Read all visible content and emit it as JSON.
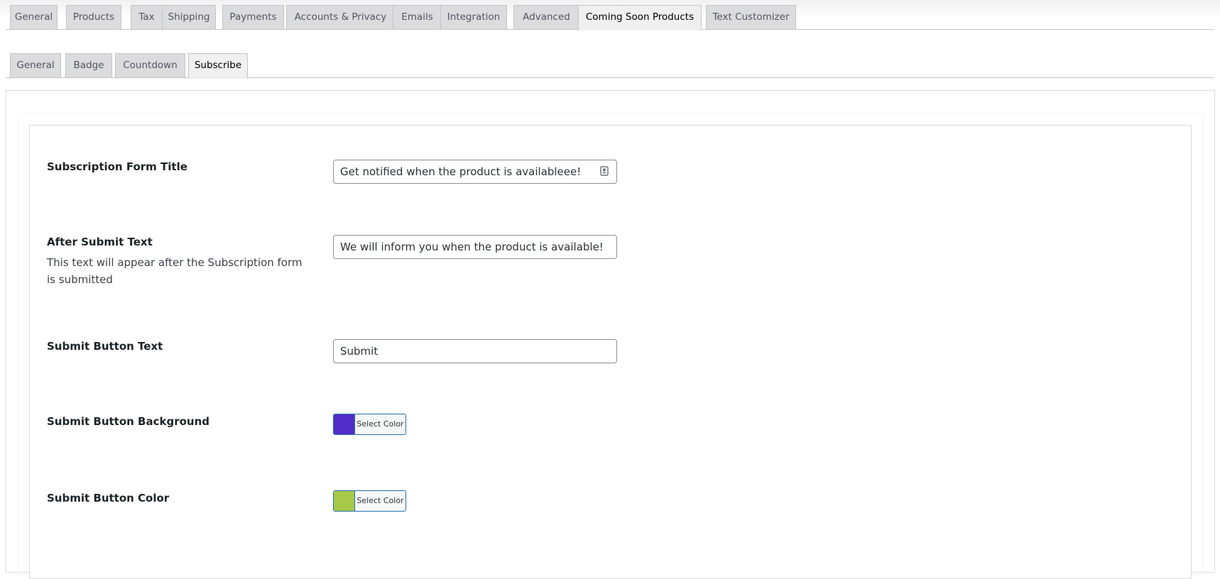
{
  "main_tabs": [
    {
      "label": "General",
      "active": false
    },
    {
      "label": "Products",
      "active": false
    },
    {
      "label": "Tax",
      "active": false
    },
    {
      "label": "Shipping",
      "active": false
    },
    {
      "label": "Payments",
      "active": false
    },
    {
      "label": "Accounts & Privacy",
      "active": false
    },
    {
      "label": "Emails",
      "active": false
    },
    {
      "label": "Integration",
      "active": false
    },
    {
      "label": "Advanced",
      "active": false
    },
    {
      "label": "Coming Soon Products",
      "active": true
    },
    {
      "label": "Text Customizer",
      "active": false
    }
  ],
  "sub_tabs": [
    {
      "label": "General",
      "active": false
    },
    {
      "label": "Badge",
      "active": false
    },
    {
      "label": "Countdown",
      "active": false
    },
    {
      "label": "Subscribe",
      "active": true
    }
  ],
  "form": {
    "title_label": "Subscription Form Title",
    "title_value": "Get notified when the product is availableee!",
    "after_submit_label": "After Submit Text",
    "after_submit_desc": "This text will appear after the Subscription form is submitted",
    "after_submit_value": "We will inform you when the product is available!",
    "submit_text_label": "Submit Button Text",
    "submit_text_value": "Submit",
    "bg_label": "Submit Button Background",
    "bg_color": "#512dc7",
    "bg_button_label": "Select Color",
    "color_label": "Submit Button Color",
    "color_color": "#a6c94a",
    "color_button_label": "Select Color"
  },
  "colors": {
    "accent": "#2271b1",
    "tab_inactive": "#dcdcde",
    "tab_active": "#f0f0f1"
  },
  "icons": {
    "title_field_icon": "password-manager-icon"
  }
}
